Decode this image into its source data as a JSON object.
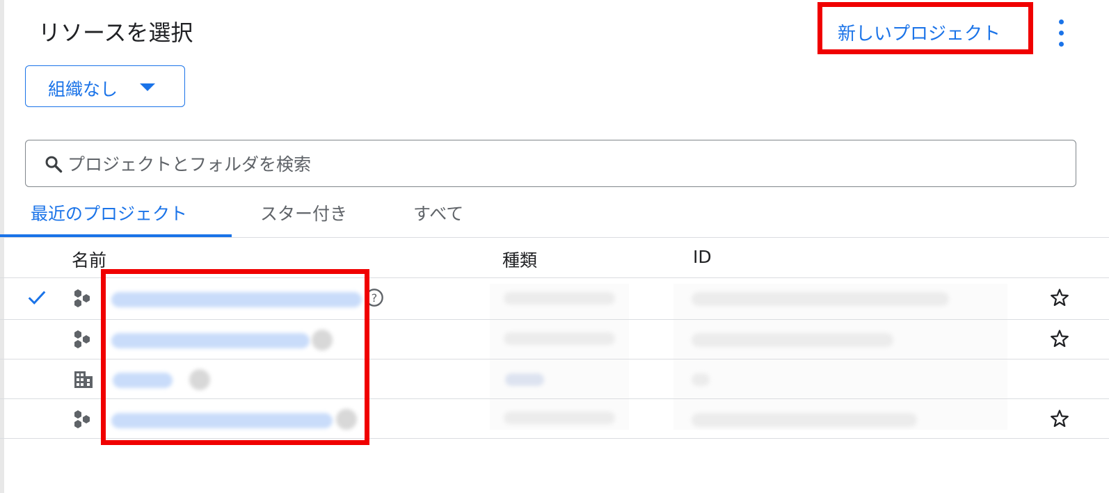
{
  "dialog": {
    "title": "リソースを選択",
    "new_project_label": "新しいプロジェクト",
    "more_menu_icon": "more-vert-icon"
  },
  "org_selector": {
    "label": "組織なし",
    "icon": "caret-down-icon"
  },
  "search": {
    "placeholder": "プロジェクトとフォルダを検索",
    "value": "",
    "icon": "search-icon"
  },
  "tabs": [
    {
      "label": "最近のプロジェクト",
      "active": true
    },
    {
      "label": "スター付き",
      "active": false
    },
    {
      "label": "すべて",
      "active": false
    }
  ],
  "table": {
    "headers": {
      "name": "名前",
      "type": "種類",
      "id": "ID"
    },
    "rows": [
      {
        "selected": true,
        "icon": "project-hexagons-icon",
        "name": "",
        "type": "",
        "id": "",
        "starred_icon": "star-outline-icon",
        "help_icon": "help-circle-icon"
      },
      {
        "selected": false,
        "icon": "project-hexagons-icon",
        "name": "",
        "type": "",
        "id": "",
        "starred_icon": "star-outline-icon"
      },
      {
        "selected": false,
        "icon": "organization-building-icon",
        "name": "",
        "type": "",
        "id": ""
      },
      {
        "selected": false,
        "icon": "project-hexagons-icon",
        "name": "",
        "type": "",
        "id": "",
        "starred_icon": "star-outline-icon"
      }
    ]
  },
  "colors": {
    "accent": "#1a73e8",
    "highlight": "#f00000",
    "divider": "#dadce0",
    "text": "#202124",
    "muted_text": "#5f6368"
  }
}
